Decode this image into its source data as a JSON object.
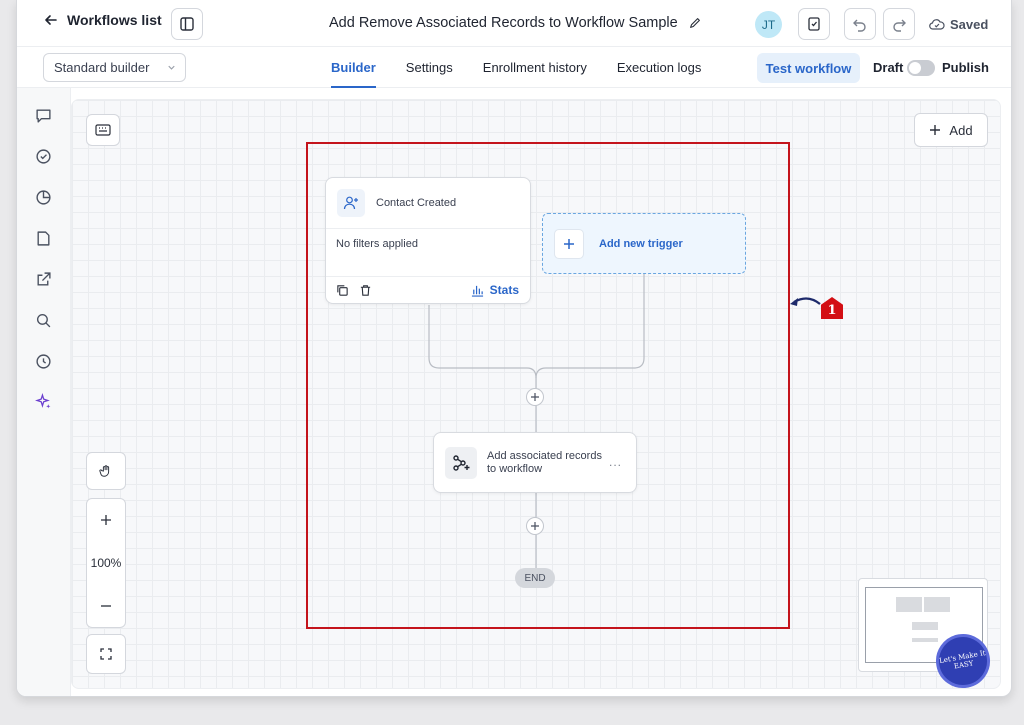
{
  "header": {
    "back_label": "Workflows list",
    "workflow_title": "Add Remove Associated Records to Workflow Sample",
    "avatar_initials": "JT",
    "saved_label": "Saved"
  },
  "subbar": {
    "builder_mode": "Standard builder",
    "tabs": [
      {
        "label": "Builder",
        "active": true
      },
      {
        "label": "Settings",
        "active": false
      },
      {
        "label": "Enrollment history",
        "active": false
      },
      {
        "label": "Execution logs",
        "active": false
      }
    ],
    "test_label": "Test workflow",
    "draft_label": "Draft",
    "publish_label": "Publish"
  },
  "canvas": {
    "add_label": "Add",
    "zoom_level": "100%",
    "trigger": {
      "title": "Contact Created",
      "filters": "No filters applied",
      "stats_label": "Stats"
    },
    "new_trigger_label": "Add new trigger",
    "action_label": "Add associated records to workflow",
    "action_more": "...",
    "end_label": "END"
  },
  "annotation": {
    "number": "1",
    "highlight_color": "#c4141c"
  },
  "badge_text": "Let's Make It EASY",
  "colors": {
    "accent": "#2a66c9",
    "highlight": "#c4141c"
  }
}
